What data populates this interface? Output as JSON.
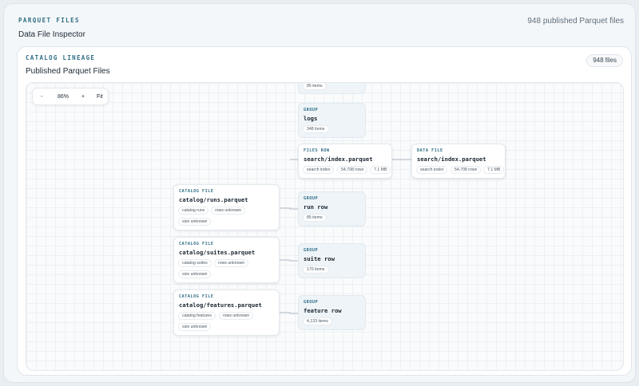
{
  "header": {
    "eyebrow": "PARQUET FILES",
    "title": "Data File Inspector",
    "file_count": "948 published Parquet files"
  },
  "panel": {
    "eyebrow": "CATALOG LINEAGE",
    "title": "Published Parquet Files",
    "files_badge": "948 files"
  },
  "zoom": {
    "minus": "-",
    "level": "86%",
    "plus": "+",
    "fit": "Fit"
  },
  "nodes": {
    "group_top": {
      "count": "85 items"
    },
    "group_logs": {
      "kind": "GROUP",
      "name": "logs",
      "count": "348 items"
    },
    "files_row": {
      "kind": "FILES ROW",
      "name": "search/index.parquet",
      "chips": [
        "search index",
        "54,708 rows",
        "7.1 MB"
      ]
    },
    "data_file": {
      "kind": "DATA FILE",
      "name": "search/index.parquet",
      "chips": [
        "search index",
        "54,708 rows",
        "7.1 MB"
      ]
    },
    "catalog_runs": {
      "kind": "CATALOG FILE",
      "name": "catalog/runs.parquet",
      "chips": [
        "catalog runs",
        "rows unknown",
        "size unknown"
      ]
    },
    "catalog_suites": {
      "kind": "CATALOG FILE",
      "name": "catalog/suites.parquet",
      "chips": [
        "catalog suites",
        "rows unknown",
        "size unknown"
      ]
    },
    "catalog_features": {
      "kind": "CATALOG FILE",
      "name": "catalog/features.parquet",
      "chips": [
        "catalog features",
        "rows unknown",
        "size unknown"
      ]
    },
    "group_run": {
      "kind": "GROUP",
      "name": "run row",
      "count": "85 items"
    },
    "group_suite": {
      "kind": "GROUP",
      "name": "suite row",
      "count": "170 items"
    },
    "group_feature": {
      "kind": "GROUP",
      "name": "feature row",
      "count": "4,133 items"
    }
  },
  "colors": {
    "accent": "#2f6e86",
    "group_tint": "#eef4f7",
    "edge": "#aebac4"
  }
}
